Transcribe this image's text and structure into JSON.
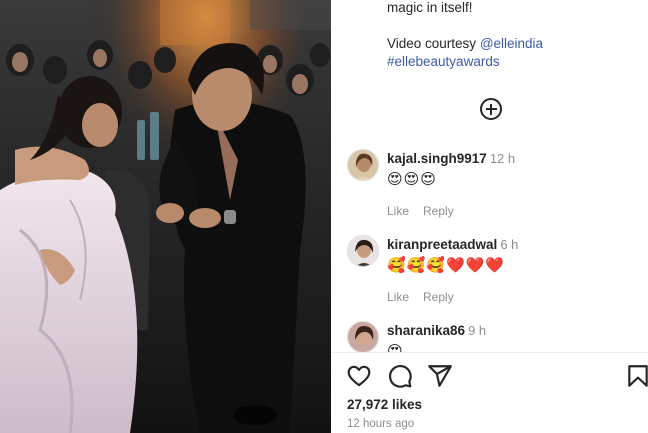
{
  "caption": {
    "line1": "magic in itself!",
    "courtesy_prefix": "Video courtesy ",
    "mention": "@elleindia",
    "hashtag": "#ellebeautyawards"
  },
  "load_more_icon": "plus-circle-icon",
  "comments": [
    {
      "username": "kajal.singh9917",
      "time": "12 h",
      "text": "😍😍😍",
      "like_label": "Like",
      "reply_label": "Reply"
    },
    {
      "username": "kiranpreetaadwal",
      "time": "6 h",
      "text": "🥰🥰🥰❤️❤️❤️",
      "like_label": "Like",
      "reply_label": "Reply"
    },
    {
      "username": "sharanika86",
      "time": "9 h",
      "text": "😍"
    }
  ],
  "actions": {
    "icons": [
      "heart-icon",
      "comment-icon",
      "share-icon",
      "bookmark-icon"
    ],
    "likes": "27,972 likes",
    "posted": "12 hours ago"
  },
  "colors": {
    "link": "#3b5ba8",
    "muted": "#8e8e8e",
    "text": "#262626"
  }
}
